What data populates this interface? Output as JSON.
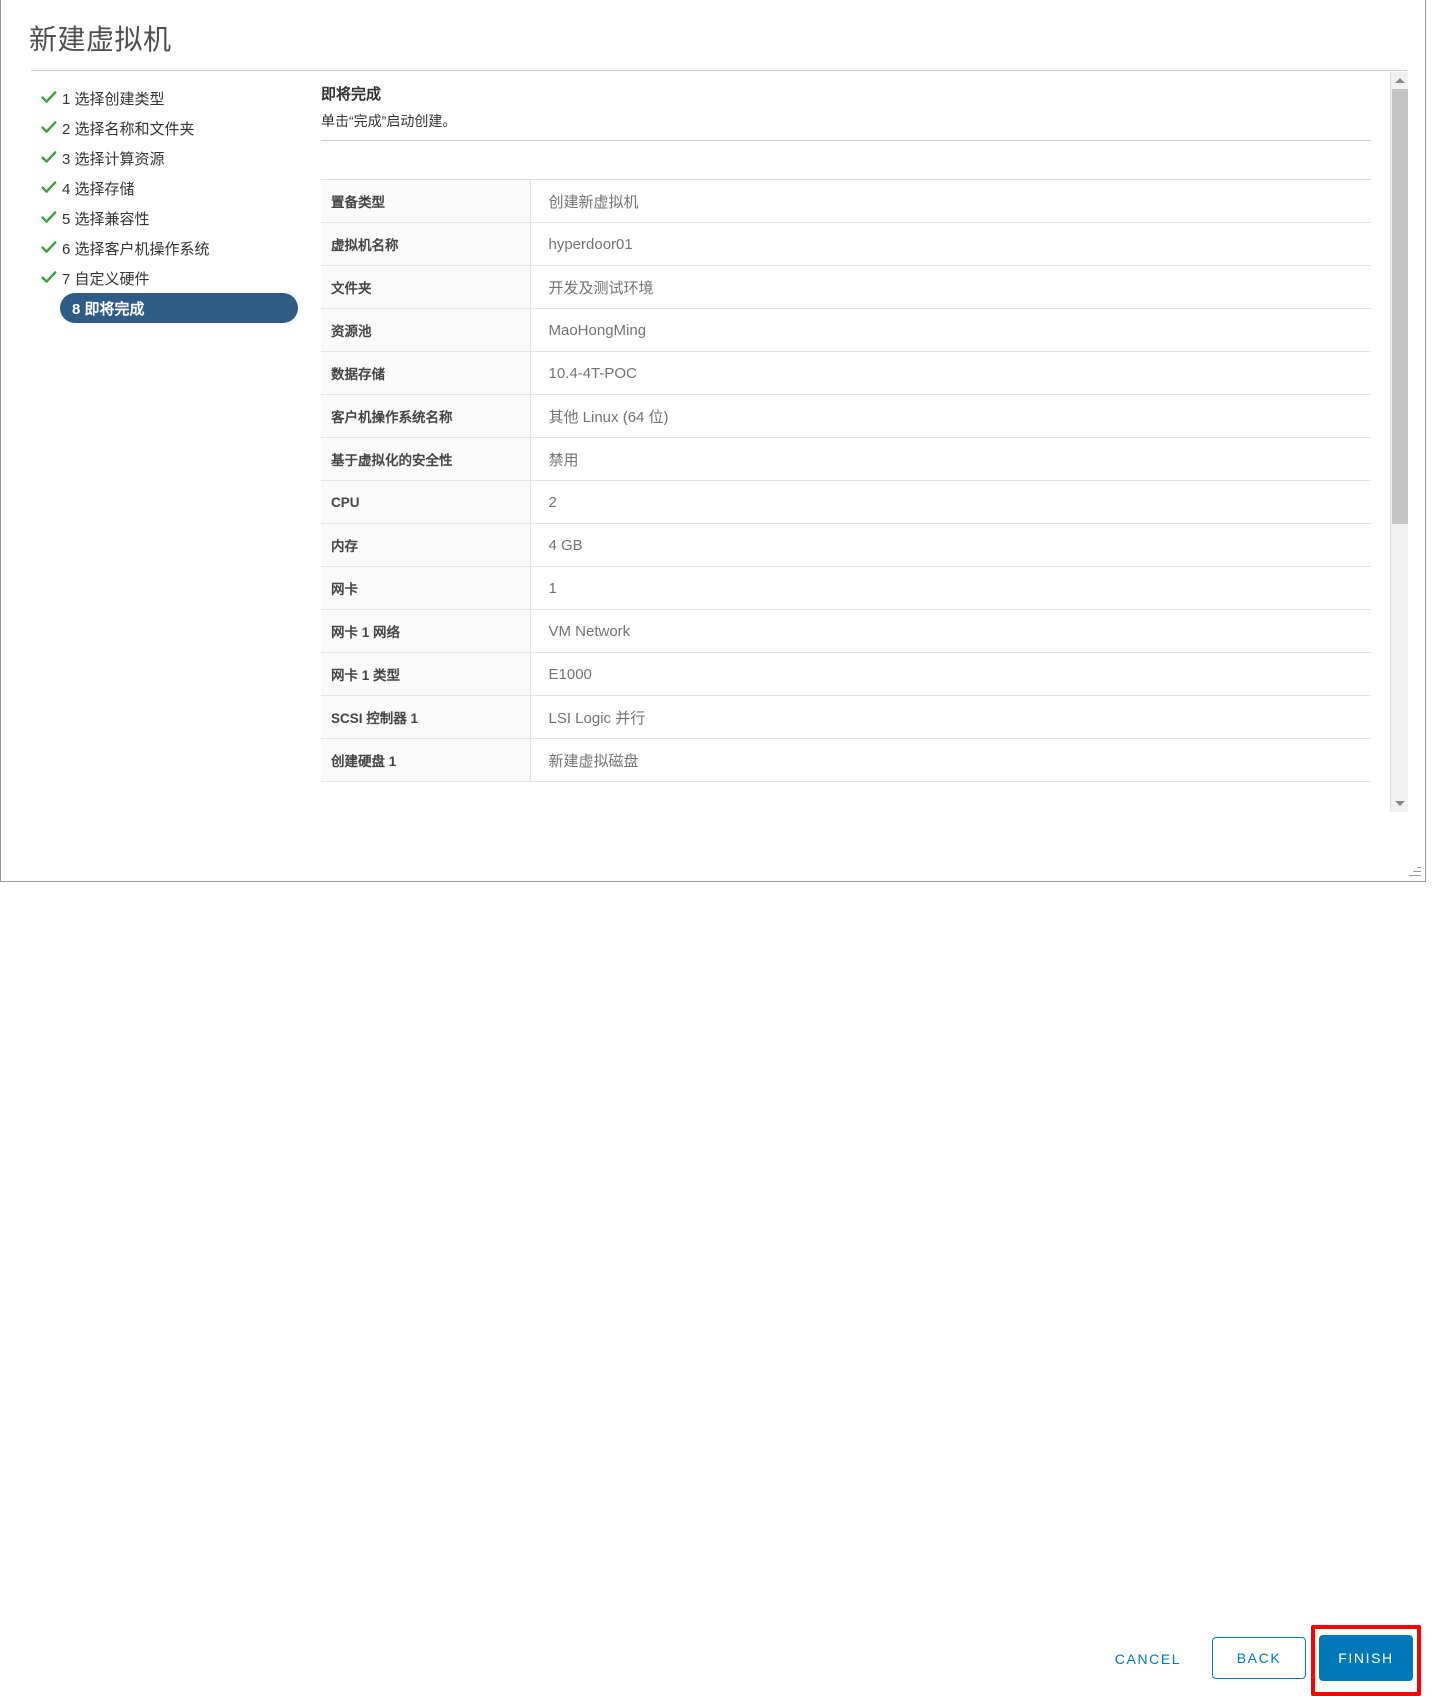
{
  "dialog": {
    "title": "新建虚拟机"
  },
  "steps": [
    {
      "num": "1",
      "label": "1 选择创建类型",
      "state": "done",
      "icon": "check-icon"
    },
    {
      "num": "2",
      "label": "2 选择名称和文件夹",
      "state": "done",
      "icon": "check-icon"
    },
    {
      "num": "3",
      "label": "3 选择计算资源",
      "state": "done",
      "icon": "check-icon"
    },
    {
      "num": "4",
      "label": "4 选择存储",
      "state": "done",
      "icon": "check-icon"
    },
    {
      "num": "5",
      "label": "5 选择兼容性",
      "state": "done",
      "icon": "check-icon"
    },
    {
      "num": "6",
      "label": "6 选择客户机操作系统",
      "state": "done",
      "icon": "check-icon"
    },
    {
      "num": "7",
      "label": "7 自定义硬件",
      "state": "done",
      "icon": "check-icon"
    },
    {
      "num": "8",
      "label": "8 即将完成",
      "state": "active",
      "icon": ""
    }
  ],
  "content": {
    "heading": "即将完成",
    "subtitle": "单击“完成”启动创建。"
  },
  "summary": {
    "rows": [
      {
        "key": "置备类型",
        "value": "创建新虚拟机"
      },
      {
        "key": "虚拟机名称",
        "value": "hyperdoor01"
      },
      {
        "key": "文件夹",
        "value": "开发及测试环境"
      },
      {
        "key": "资源池",
        "value": "MaoHongMing"
      },
      {
        "key": "数据存储",
        "value": "10.4-4T-POC"
      },
      {
        "key": "客户机操作系统名称",
        "value": "其他 Linux (64 位)"
      },
      {
        "key": "基于虚拟化的安全性",
        "value": "禁用"
      },
      {
        "key": "CPU",
        "value": "2"
      },
      {
        "key": "内存",
        "value": "4 GB"
      },
      {
        "key": "网卡",
        "value": "1"
      },
      {
        "key": "网卡 1 网络",
        "value": "VM Network"
      },
      {
        "key": "网卡 1 类型",
        "value": "E1000"
      },
      {
        "key": "SCSI 控制器 1",
        "value": "LSI Logic 并行"
      },
      {
        "key": "创建硬盘 1",
        "value": "新建虚拟磁盘"
      }
    ]
  },
  "footer": {
    "cancel_label": "CANCEL",
    "back_label": "BACK",
    "finish_label": "FINISH"
  },
  "scrollbar": {
    "up_icon": "chevron-up-icon",
    "down_icon": "chevron-down-icon"
  },
  "colors": {
    "accent_blue": "#0079b8",
    "active_step": "#2f5c86",
    "check_green": "#3ca03c",
    "highlight_red": "#fe0000",
    "key_cell_bg": "#fafafa"
  }
}
